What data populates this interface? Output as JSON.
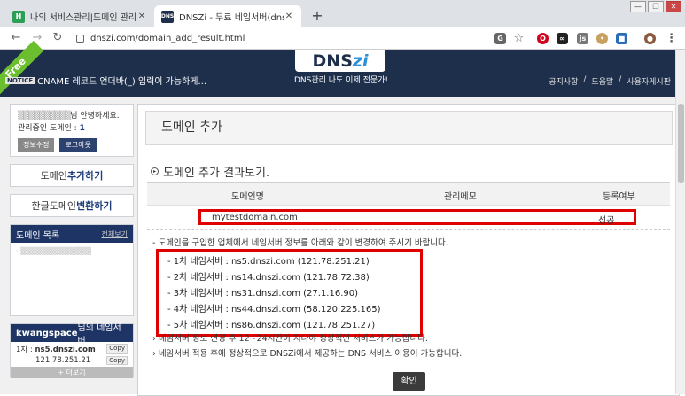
{
  "browser": {
    "tabs": [
      {
        "title": "나의 서비스관리|도메인 관리|보...",
        "favicon_text": "H",
        "favicon_color": "#2d9e55"
      },
      {
        "title": "DNSZi - 무료 네임서버(dns) 관리...",
        "favicon_text": "DNS",
        "favicon_color": "#1e2f4b"
      }
    ],
    "url": "dnszi.com/domain_add_result.html"
  },
  "banner": {
    "free": "Free",
    "notice_badge": "NOTICE",
    "notice": "CNAME 레코드 언더바(_) 입력이 가능하게...",
    "logo_a": "DNS",
    "logo_b": "zi",
    "tagline": "DNS관리 나도 이제 전문가!",
    "links": [
      "공지사항",
      "/",
      "도움말",
      "/",
      "사용자게시판"
    ]
  },
  "sidebar": {
    "greeting_suffix": "님 안녕하세요.",
    "domains_label": "관리중인 도메인 :",
    "domains_count": "1",
    "edit_info": "정보수정",
    "logout": "로그아웃",
    "add_domain_a": "도메인 ",
    "add_domain_b": "추가하기",
    "convert_a": "한글도메인 ",
    "convert_b": "변환하기",
    "domain_list_title": "도메인 목록",
    "view_all": "전체보기",
    "ns_title_user": "kwangspace",
    "ns_title_suffix": "님의 네임서버",
    "ns": [
      {
        "label": "1차 :",
        "host": "ns5.dnszi.com",
        "ip": "121.78.251.21",
        "copy": "Copy"
      }
    ],
    "more": "+ 더보기"
  },
  "main": {
    "title": "도메인 추가",
    "section": "도메인 추가 결과보기.",
    "headers": [
      "도메인명",
      "관리메모",
      "등록여부"
    ],
    "result": {
      "domain": "mytestdomain.com",
      "memo": "",
      "status": "성공"
    },
    "instruction": "- 도메인을 구입한 업체에서 네임서버 정보를 아래와 같이 변경하여 주시기 바랍니다.",
    "nameservers": [
      "- 1차 네임서버 : ns5.dnszi.com (121.78.251.21)",
      "- 2차 네임서버 : ns14.dnszi.com (121.78.72.38)",
      "- 3차 네임서버 : ns31.dnszi.com (27.1.16.90)",
      "- 4차 네임서버 : ns44.dnszi.com (58.120.225.165)",
      "- 5차 네임서버 : ns86.dnszi.com (121.78.251.27)"
    ],
    "notes": [
      "› 네임서버 정보 변경 후 12~24시간이 지나야 정상적인 서비스가 가능합니다.",
      "› 네임서버 적용 후에 정상적으로 DNSZi에서 제공하는 DNS 서비스 이용이 가능합니다."
    ],
    "ok": "확인"
  }
}
